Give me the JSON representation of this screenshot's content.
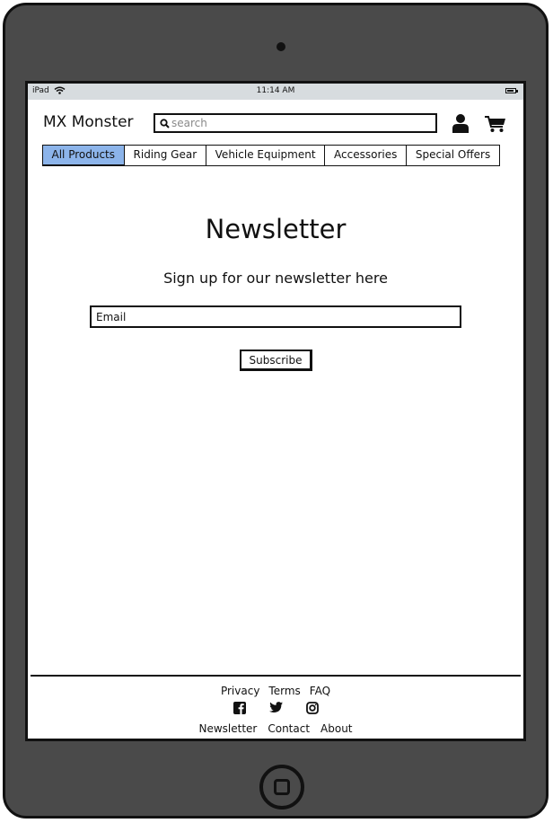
{
  "device": {
    "name": "iPad"
  },
  "statusbar": {
    "carrier": "iPad",
    "time": "11:14 AM"
  },
  "header": {
    "brand": "MX Monster",
    "search_placeholder": "search"
  },
  "nav": {
    "tabs": [
      {
        "label": "All Products",
        "active": true
      },
      {
        "label": "Riding Gear",
        "active": false
      },
      {
        "label": "Vehicle Equipment",
        "active": false
      },
      {
        "label": "Accessories",
        "active": false
      },
      {
        "label": "Special Offers",
        "active": false
      }
    ]
  },
  "main": {
    "title": "Newsletter",
    "subtitle": "Sign up for our newsletter here",
    "email_placeholder": "Email",
    "subscribe_label": "Subscribe"
  },
  "footer": {
    "links_top": [
      "Privacy",
      "Terms",
      "FAQ"
    ],
    "social_icons": [
      "facebook-icon",
      "twitter-icon",
      "instagram-icon"
    ],
    "links_bottom": [
      "Newsletter",
      "Contact",
      "About"
    ]
  },
  "colors": {
    "active_tab": "#8cb4ea",
    "device_frame": "#4a4a4a",
    "statusbar": "#d7dcdf"
  }
}
